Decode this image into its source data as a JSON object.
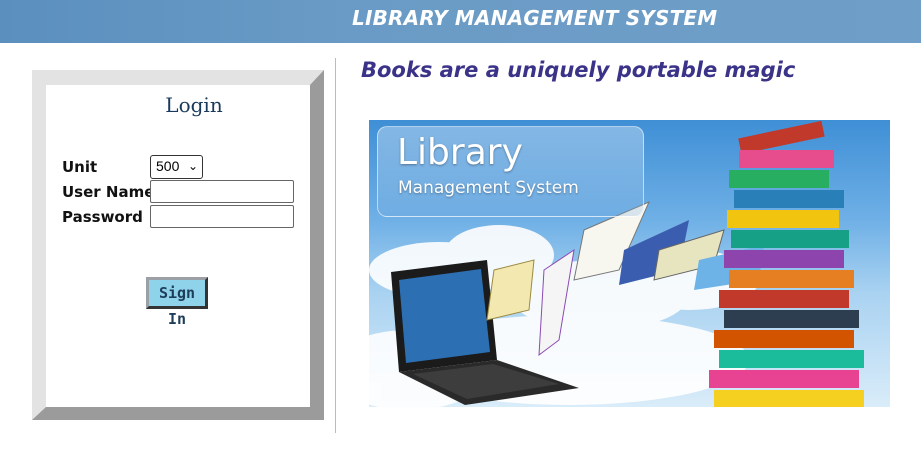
{
  "header": {
    "title": "LIBRARY MANAGEMENT SYSTEM"
  },
  "login": {
    "title": "Login",
    "unit_label": "Unit",
    "unit_value": "500",
    "username_label": "User Name",
    "username_value": "",
    "password_label": "Password",
    "password_value": "",
    "signin_label": "Sign In"
  },
  "tagline": "Books are a uniquely portable magic",
  "banner": {
    "title": "Library",
    "subtitle": "Management System"
  },
  "icons": {
    "select": "chevron-down-icon"
  },
  "colors": {
    "header_bg": "#6a9bc6",
    "tagline": "#3b3388",
    "signin_bg": "#8fd3ea"
  }
}
